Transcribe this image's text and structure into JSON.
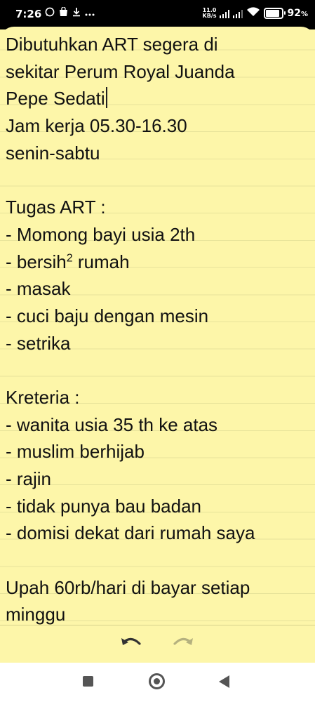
{
  "status": {
    "time": "7:26",
    "net_speed_value": "11.0",
    "net_speed_unit": "KB/s",
    "battery": "92",
    "battery_suffix": "%",
    "battery_level": 0.92
  },
  "note": {
    "lines": [
      "Dibutuhkan ART segera di",
      "sekitar Perum Royal Juanda",
      "Pepe Sedati",
      "Jam kerja 05.30-16.30",
      "senin-sabtu",
      "",
      "Tugas ART :",
      "- Momong bayi usia 2th",
      "- bersih",
      "- masak",
      "- cuci baju dengan mesin",
      "- setrika",
      "",
      "Kreteria :",
      "- wanita usia 35 th ke atas",
      "- muslim berhijab",
      "- rajin",
      "- tidak punya bau badan",
      "- domisi dekat dari rumah saya",
      "",
      "Upah 60rb/hari di bayar setiap",
      "minggu"
    ],
    "line9_sup": "2",
    "line9_rest": " rumah"
  },
  "toolbar": {
    "undo_icon": "undo-icon",
    "redo_icon": "redo-icon"
  },
  "colors": {
    "note_bg": "#fdf6a9",
    "rule": "#e7e39a"
  }
}
